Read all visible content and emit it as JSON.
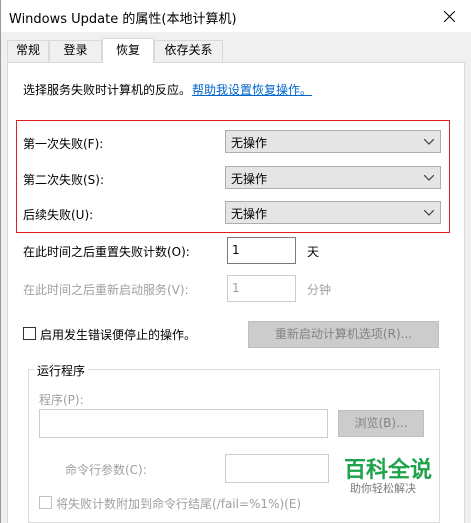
{
  "window": {
    "title": "Windows Update 的属性(本地计算机)"
  },
  "tabs": [
    {
      "label": "常规",
      "active": false
    },
    {
      "label": "登录",
      "active": false
    },
    {
      "label": "恢复",
      "active": true
    },
    {
      "label": "依存关系",
      "active": false
    }
  ],
  "recovery": {
    "intro_text": "选择服务失败时计算机的反应。",
    "help_link": "帮助我设置恢复操作。",
    "first_failure": {
      "label": "第一次失败(F):",
      "value": "无操作"
    },
    "second_failure": {
      "label": "第二次失败(S):",
      "value": "无操作"
    },
    "subsequent_failures": {
      "label": "后续失败(U):",
      "value": "无操作"
    },
    "reset_count": {
      "label": "在此时间之后重置失败计数(O):",
      "value": "1",
      "unit": "天"
    },
    "restart_service": {
      "label": "在此时间之后重新启动服务(V):",
      "value": "1",
      "unit": "分钟"
    },
    "enable_error_stop": {
      "label": "启用发生错误便停止的操作。",
      "checked": false
    },
    "restart_options_button": "重新启动计算机选项(R)...",
    "run_program": {
      "group_title": "运行程序",
      "program_label": "程序(P):",
      "program_value": "",
      "browse_button": "浏览(B)...",
      "cmd_params_label": "命令行参数(C):",
      "cmd_params_value": "",
      "append_fail_count": {
        "label": "将失败计数附加到命令行结尾(/fail=%1%)(E)",
        "checked": false
      }
    }
  },
  "watermark": {
    "title": "百科全说",
    "subtitle": "助你轻松解决",
    "color": "#1da34a"
  },
  "colors": {
    "highlight_border": "#e02020",
    "link": "#0066cc"
  }
}
